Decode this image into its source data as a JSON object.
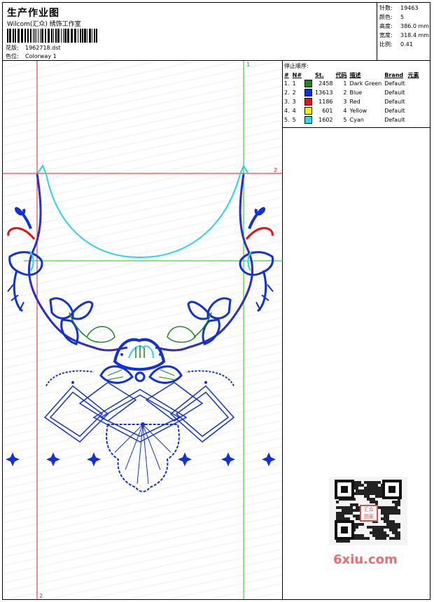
{
  "header": {
    "title": "生产作业图",
    "company": "Wilcom(汇众) 绣饰工作室",
    "design_label": "花版:",
    "design_value": "1962718.dst",
    "colorway_label": "色位:",
    "colorway_value": "Colorway 1"
  },
  "stats": [
    {
      "label": "针数:",
      "value": "19463"
    },
    {
      "label": "颜色:",
      "value": "5"
    },
    {
      "label": "高度:",
      "value": "386.0 mm"
    },
    {
      "label": "宽度:",
      "value": "318.4 mm"
    },
    {
      "label": "比例:",
      "value": "0.41"
    }
  ],
  "stop_sequence": {
    "heading": "停止顺序:",
    "columns": [
      "#",
      "N#",
      "St.",
      "代码",
      "描述",
      "Brand",
      "元素"
    ],
    "rows": [
      {
        "idx": "1.",
        "n": "1",
        "stitches": "2458",
        "code": "1",
        "desc": "Dark Green",
        "brand": "Default",
        "color": "#1a8a1a"
      },
      {
        "idx": "2.",
        "n": "2",
        "stitches": "13613",
        "code": "2",
        "desc": "Blue",
        "brand": "Default",
        "color": "#1030e0"
      },
      {
        "idx": "3.",
        "n": "3",
        "stitches": "1186",
        "code": "3",
        "desc": "Red",
        "brand": "Default",
        "color": "#ee1010"
      },
      {
        "idx": "4.",
        "n": "4",
        "stitches": "601",
        "code": "4",
        "desc": "Yellow",
        "brand": "Default",
        "color": "#f2f200"
      },
      {
        "idx": "5.",
        "n": "5",
        "stitches": "1602",
        "code": "5",
        "desc": "Cyan",
        "brand": "Default",
        "color": "#20e0ee"
      }
    ]
  },
  "guide_marks": {
    "top": "1",
    "right": "2",
    "bottom": "2"
  },
  "watermark": "6xiu.com",
  "qr_stamp": "汇众 图案",
  "colors": {
    "blue": "#1030e0",
    "cyan": "#20d8e8",
    "red": "#ee1010",
    "green": "#1a8a1a",
    "guide_red": "#e02020",
    "guide_green": "#20c020"
  }
}
